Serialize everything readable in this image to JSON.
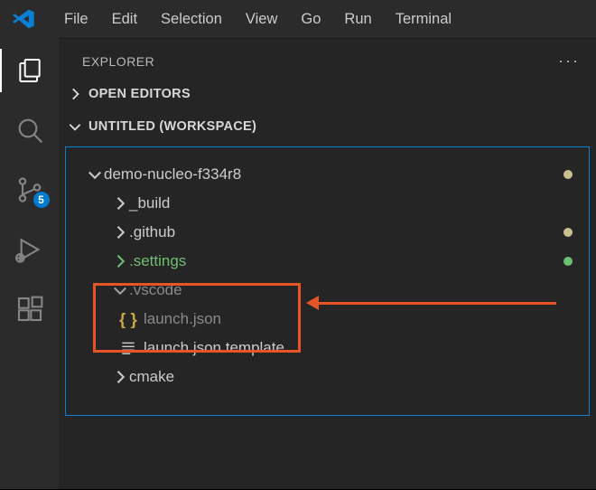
{
  "menubar": {
    "items": [
      "File",
      "Edit",
      "Selection",
      "View",
      "Go",
      "Run",
      "Terminal"
    ]
  },
  "activitybar": {
    "scm_badge": "5"
  },
  "explorer": {
    "title": "EXPLORER",
    "sections": {
      "open_editors": "OPEN EDITORS",
      "workspace": "UNTITLED (WORKSPACE)"
    }
  },
  "tree": {
    "root": "demo-nucleo-f334r8",
    "build": "_build",
    "github": ".github",
    "settings": ".settings",
    "vscode": ".vscode",
    "launch": "launch.json",
    "launch_template": "launch.json.template",
    "cmake": "cmake"
  }
}
